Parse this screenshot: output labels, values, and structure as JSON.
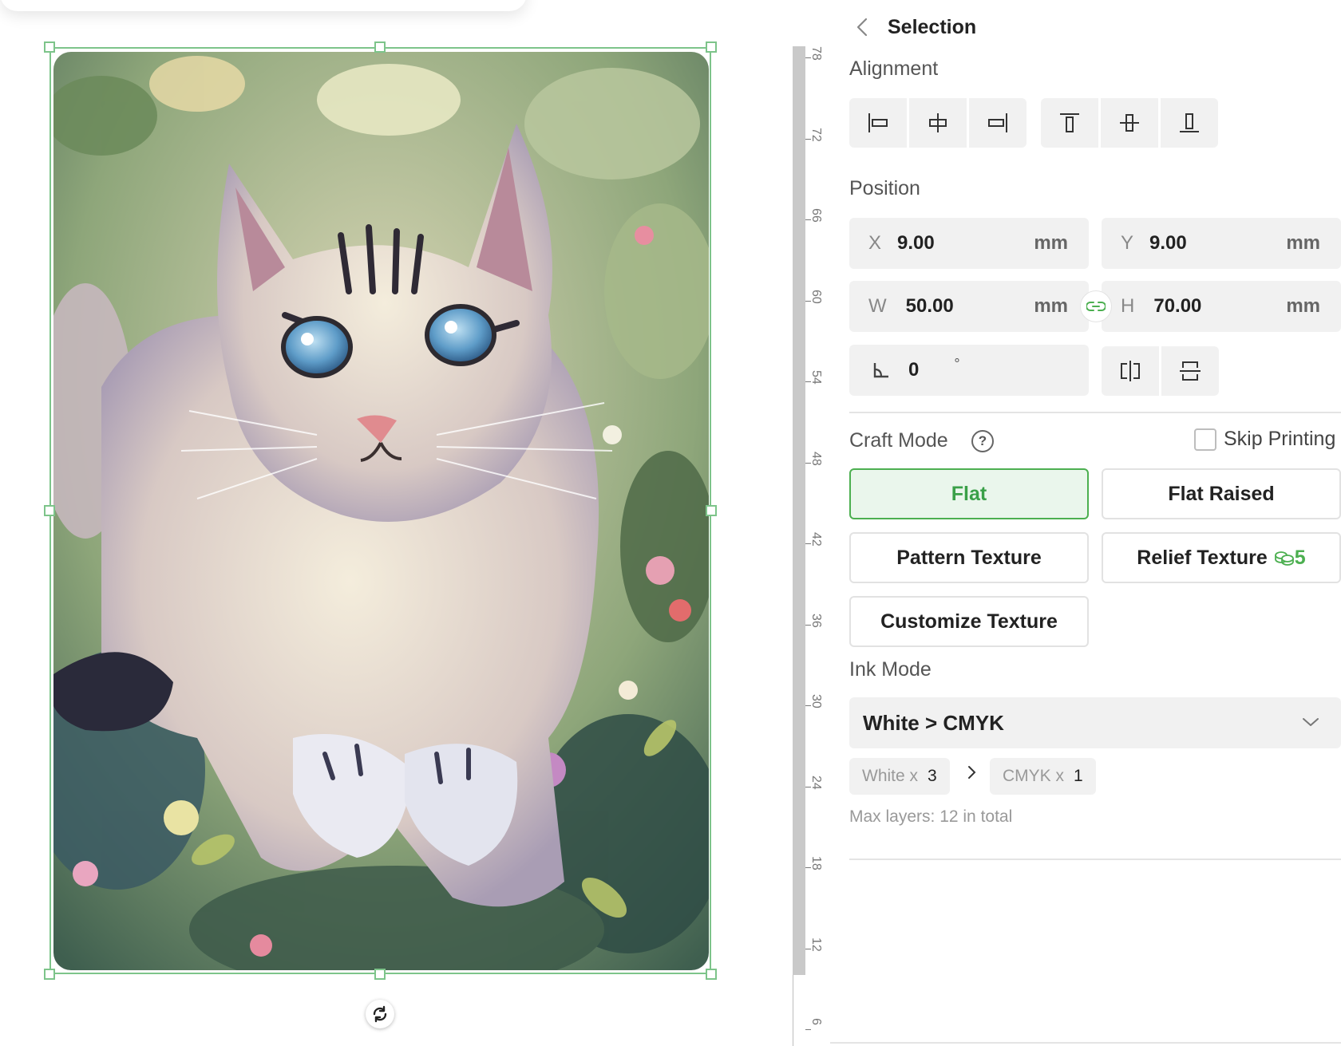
{
  "canvas": {
    "ruler_labels": [
      "78",
      "72",
      "66",
      "60",
      "54",
      "48",
      "42",
      "36",
      "30",
      "24",
      "18",
      "12",
      "6"
    ]
  },
  "panel": {
    "title": "Selection",
    "alignment": {
      "label": "Alignment",
      "buttons": [
        "align-left",
        "align-horizontal-center",
        "align-right",
        "align-top",
        "align-vertical-middle",
        "align-bottom"
      ]
    },
    "position": {
      "label": "Position",
      "x": {
        "label": "X",
        "value": "9.00",
        "unit": "mm"
      },
      "y": {
        "label": "Y",
        "value": "9.00",
        "unit": "mm"
      },
      "w": {
        "label": "W",
        "value": "50.00",
        "unit": "mm"
      },
      "h": {
        "label": "H",
        "value": "70.00",
        "unit": "mm"
      },
      "rotation": {
        "value": "0",
        "unit": "°"
      }
    },
    "craft_mode": {
      "label": "Craft Mode",
      "help": "?",
      "skip_printing": {
        "label": "Skip Printing",
        "checked": false
      },
      "options": {
        "flat": "Flat",
        "flat_raised": "Flat Raised",
        "pattern_texture": "Pattern Texture",
        "relief_texture": "Relief Texture",
        "relief_cost": "5",
        "customize_texture": "Customize Texture"
      },
      "selected": "Flat"
    },
    "ink_mode": {
      "label": "Ink Mode",
      "value": "White > CMYK",
      "white": {
        "label": "White x",
        "count": "3"
      },
      "cmyk": {
        "label": "CMYK x",
        "count": "1"
      },
      "max_layers": "Max layers: 12 in total"
    },
    "colors": {
      "accent": "#4caf50",
      "selection": "#7dc48a"
    }
  }
}
